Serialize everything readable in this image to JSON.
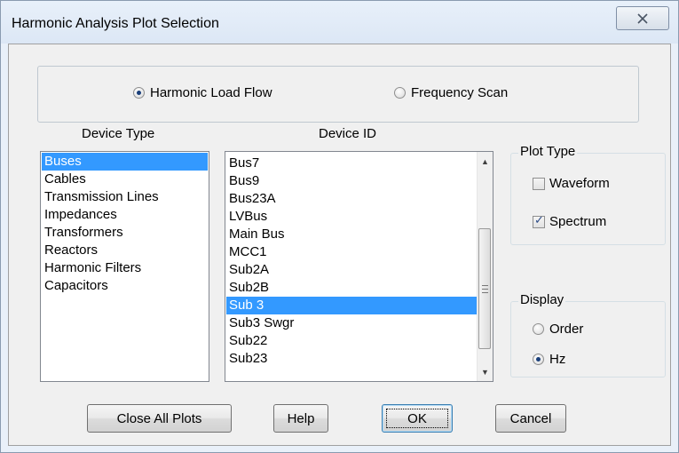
{
  "window": {
    "title": "Harmonic Analysis Plot Selection"
  },
  "analysis_mode": {
    "options": [
      {
        "label": "Harmonic Load Flow",
        "checked": true
      },
      {
        "label": "Frequency Scan",
        "checked": false
      }
    ]
  },
  "device_type": {
    "title": "Device Type",
    "items": [
      "Buses",
      "Cables",
      "Transmission Lines",
      "Impedances",
      "Transformers",
      "Reactors",
      "Harmonic Filters",
      "Capacitors"
    ],
    "selected": "Buses"
  },
  "device_id": {
    "title": "Device ID",
    "items": [
      "Bus7",
      "Bus9",
      "Bus23A",
      "LVBus",
      "Main Bus",
      "MCC1",
      "Sub2A",
      "Sub2B",
      "Sub 3",
      "Sub3 Swgr",
      "Sub22",
      "Sub23"
    ],
    "selected": "Sub 3"
  },
  "plot_type": {
    "title": "Plot Type",
    "options": [
      {
        "label": "Waveform",
        "checked": false
      },
      {
        "label": "Spectrum",
        "checked": true
      }
    ]
  },
  "display": {
    "title": "Display",
    "options": [
      {
        "label": "Order",
        "checked": false
      },
      {
        "label": "Hz",
        "checked": true
      }
    ]
  },
  "buttons": {
    "close_all_plots": "Close All Plots",
    "help": "Help",
    "ok": "OK",
    "cancel": "Cancel"
  },
  "icons": {
    "close": "close-icon",
    "scroll_up": "scroll-up-arrow-icon",
    "scroll_down": "scroll-down-arrow-icon",
    "scroll_grip": "scroll-grip-icon"
  },
  "colors": {
    "selection": "#3399ff",
    "dialog_face": "#f0f0f0",
    "title_bar": "#dce7f5"
  }
}
